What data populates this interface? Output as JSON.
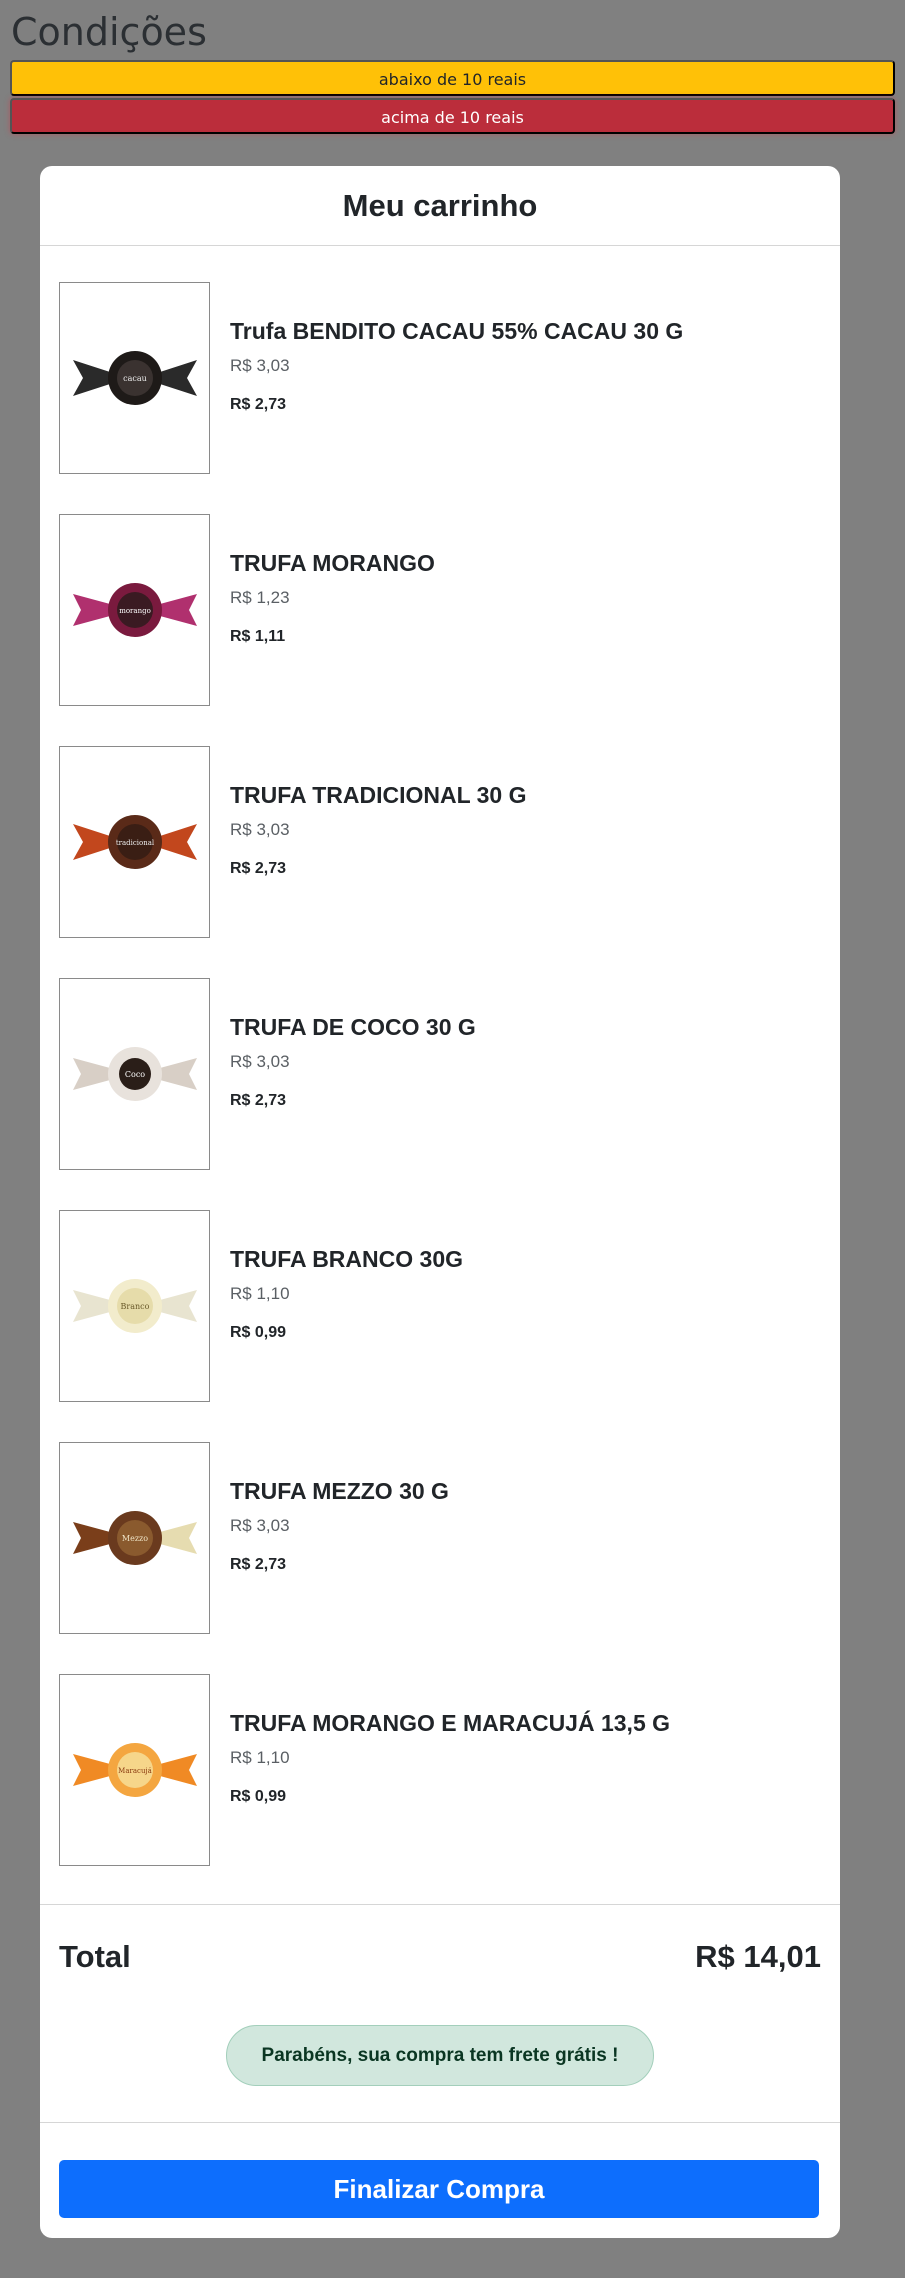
{
  "header": {
    "title": "Condições"
  },
  "conditions": {
    "below_label": "abaixo de 10 reais",
    "above_label": "acima de 10 reais",
    "below_color": "#ffc107",
    "above_color": "#bb2d3b"
  },
  "cart": {
    "title": "Meu carrinho",
    "items": [
      {
        "name": "Trufa BENDITO CACAU 55% CACAU 30 G",
        "price": "R$ 3,03",
        "discount_price": "R$ 2,73",
        "image": "dark-truffle-icon"
      },
      {
        "name": "TRUFA MORANGO",
        "price": "R$ 1,23",
        "discount_price": "R$ 1,11",
        "image": "strawberry-truffle-icon"
      },
      {
        "name": "TRUFA TRADICIONAL 30 G",
        "price": "R$ 3,03",
        "discount_price": "R$ 2,73",
        "image": "traditional-truffle-icon"
      },
      {
        "name": "TRUFA DE COCO 30 G",
        "price": "R$ 3,03",
        "discount_price": "R$ 2,73",
        "image": "coconut-truffle-icon"
      },
      {
        "name": "TRUFA BRANCO 30G",
        "price": "R$ 1,10",
        "discount_price": "R$ 0,99",
        "image": "white-truffle-icon"
      },
      {
        "name": "TRUFA MEZZO 30 G",
        "price": "R$ 3,03",
        "discount_price": "R$ 2,73",
        "image": "mezzo-truffle-icon"
      },
      {
        "name": "TRUFA MORANGO E MARACUJÁ 13,5 G",
        "price": "R$ 1,10",
        "discount_price": "R$ 0,99",
        "image": "passionfruit-truffle-icon"
      }
    ],
    "total_label": "Total",
    "total_value": "R$ 14,01",
    "free_shipping_message": "Parabéns, sua compra tem frete grátis !",
    "checkout_label": "Finalizar Compra"
  },
  "colors": {
    "background": "#808080",
    "primary": "#0d6efd",
    "success_bg": "#d1e7dd",
    "success_text": "#0a3622"
  }
}
